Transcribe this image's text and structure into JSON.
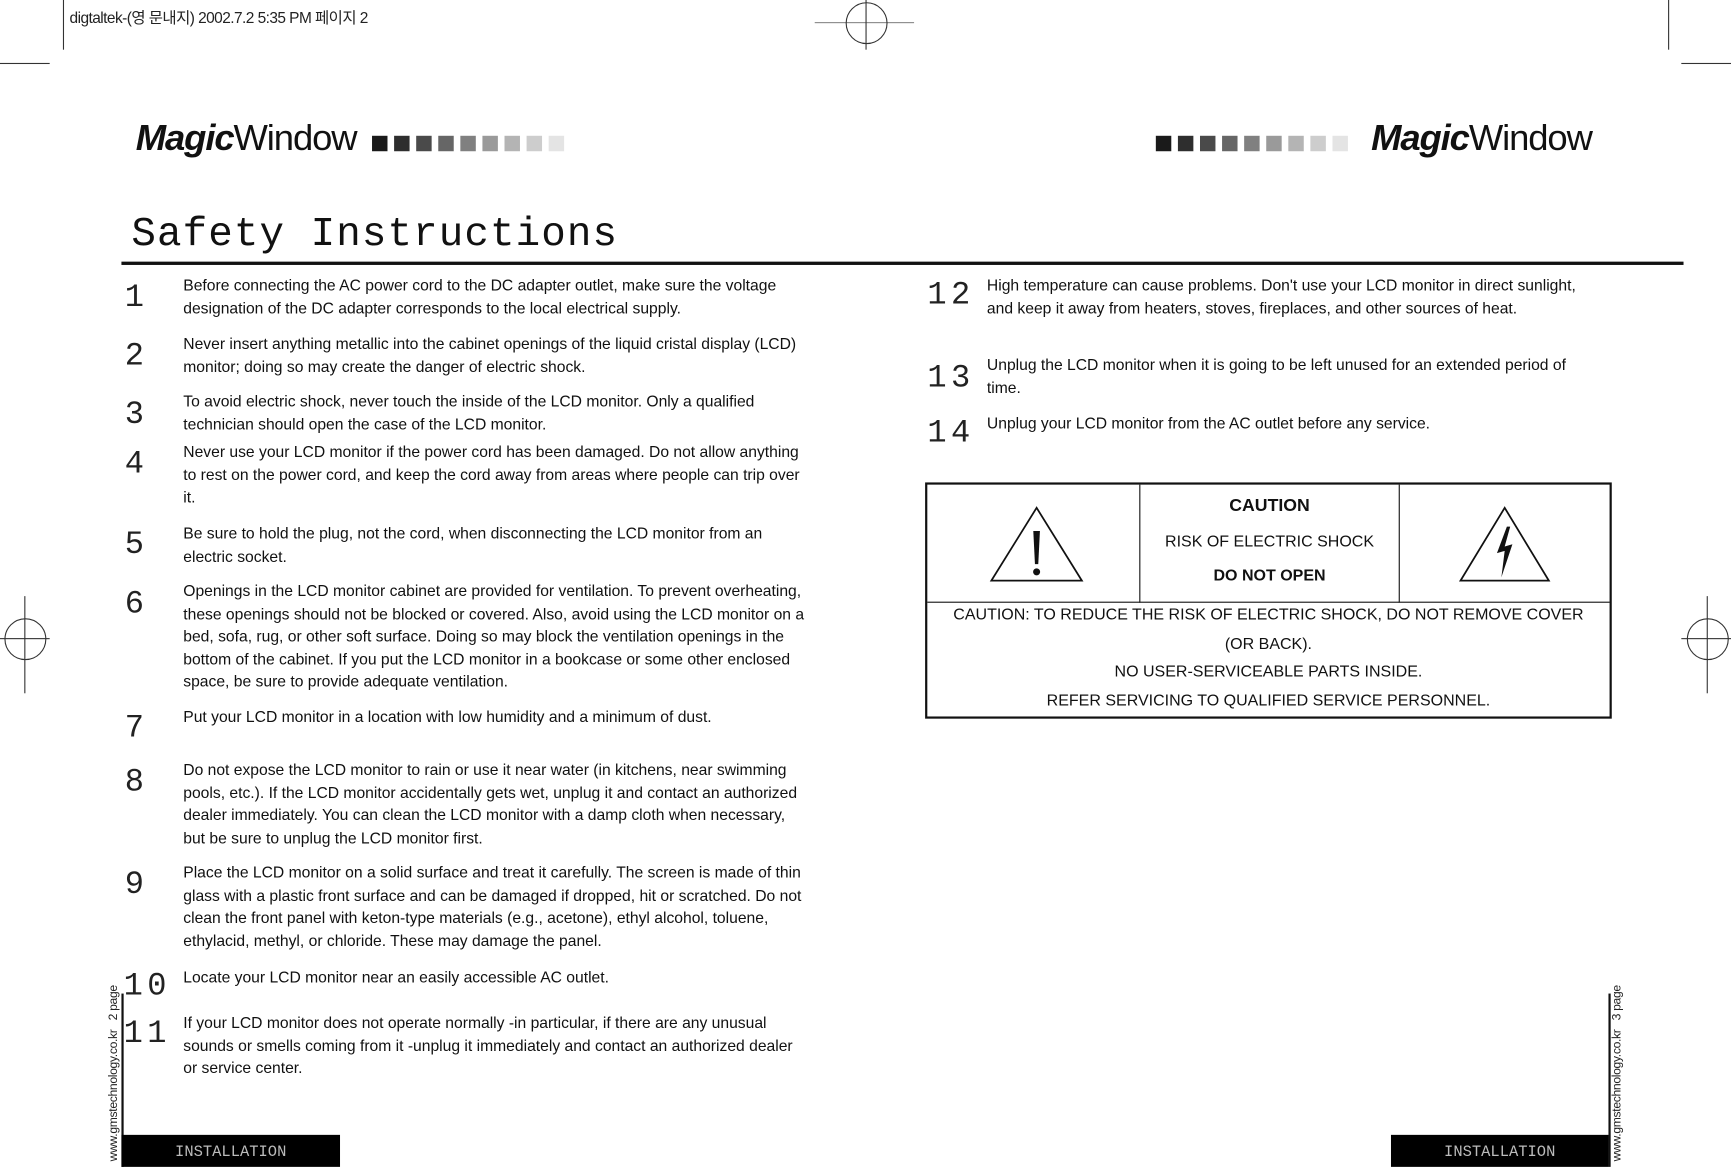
{
  "slug": "digtaltek-(영 문내지) 2002.7.2 5:35 PM 페이지 2",
  "logo": {
    "bold": "Magic",
    "light": "Window"
  },
  "logo_squares": [
    "#1a1a1a",
    "#2e2e2e",
    "#4a4a4a",
    "#666666",
    "#808080",
    "#9a9a9a",
    "#b4b4b4",
    "#cdcdcd",
    "#e4e4e4"
  ],
  "title": "Safety Instructions",
  "left_items": [
    {
      "num": "1",
      "text": "Before connecting the AC power cord to the DC adapter outlet, make sure the voltage designation of the DC adapter corresponds to the local electrical supply."
    },
    {
      "num": "2",
      "text": "Never insert anything metallic into the cabinet openings of the liquid cristal display (LCD) monitor; doing so may create the danger of electric shock."
    },
    {
      "num": "3",
      "text": "To avoid electric shock, never touch the inside of the LCD monitor. Only a qualified technician should open the case of the LCD monitor."
    },
    {
      "num": "4",
      "text": "Never use your LCD monitor if the power cord has been damaged. Do not allow anything to rest on the power cord, and keep the cord away from areas where people can trip over it."
    },
    {
      "num": "5",
      "text": "Be sure to hold the plug, not the cord, when disconnecting the LCD monitor from an electric socket."
    },
    {
      "num": "6",
      "text": "Openings in the LCD monitor cabinet are provided for ventilation. To prevent overheating, these openings should not be blocked or covered. Also, avoid using the LCD monitor on a bed, sofa, rug, or other soft surface. Doing so may block the ventilation openings in the bottom of the cabinet. If you put the LCD monitor in a bookcase or some other enclosed space, be sure to provide adequate ventilation."
    },
    {
      "num": "7",
      "text": "Put your LCD monitor in a location with low humidity and a minimum of dust."
    },
    {
      "num": "8",
      "text": "Do not expose the LCD monitor to rain or use it near water (in kitchens, near swimming pools, etc.). If the LCD monitor accidentally gets wet, unplug it and contact an authorized dealer immediately. You can clean the LCD monitor with a damp cloth when necessary, but be sure to unplug the LCD monitor first."
    },
    {
      "num": "9",
      "text": "Place the LCD monitor on a solid surface and treat it carefully. The screen is made of thin glass with a plastic front surface and can be damaged if dropped, hit or scratched. Do not clean the front panel with keton-type materials (e.g., acetone), ethyl alcohol, toluene, ethylacid, methyl, or chloride. These may damage the panel."
    },
    {
      "num": "10",
      "text": "Locate your LCD monitor near an easily accessible AC outlet."
    },
    {
      "num": "11",
      "text": "If your LCD monitor does not operate normally -in particular, if there are any unusual sounds or smells coming from it -unplug it immediately and contact an authorized dealer or service center."
    }
  ],
  "right_items": [
    {
      "num": "12",
      "text": "High temperature can cause problems. Don't use your LCD monitor in direct sunlight, and keep it away from heaters, stoves, fireplaces, and other sources of heat."
    },
    {
      "num": "13",
      "text": "Unplug the LCD monitor when it is going to be left unused for an extended period of time."
    },
    {
      "num": "14",
      "text": "Unplug your LCD monitor from the AC outlet before any service."
    }
  ],
  "caution": {
    "heading": "CAUTION",
    "risk": "RISK OF ELECTRIC SHOCK",
    "do_not_open": "DO NOT OPEN",
    "line1": "CAUTION: TO REDUCE THE RISK OF ELECTRIC SHOCK, DO NOT REMOVE COVER",
    "line2": "(OR BACK).",
    "line3": "NO USER-SERVICEABLE PARTS INSIDE.",
    "line4": "REFER SERVICING TO QUALIFIED SERVICE PERSONNEL.",
    "left_icon": "exclamation-warning-icon",
    "right_icon": "lightning-warning-icon"
  },
  "footer": {
    "left_section": "INSTALLATION",
    "right_section": "INSTALLATION",
    "left_side": "www.gmstechnology.co.kr   2 page",
    "right_side": "www.gmstechnology.co.kr   3 page"
  }
}
